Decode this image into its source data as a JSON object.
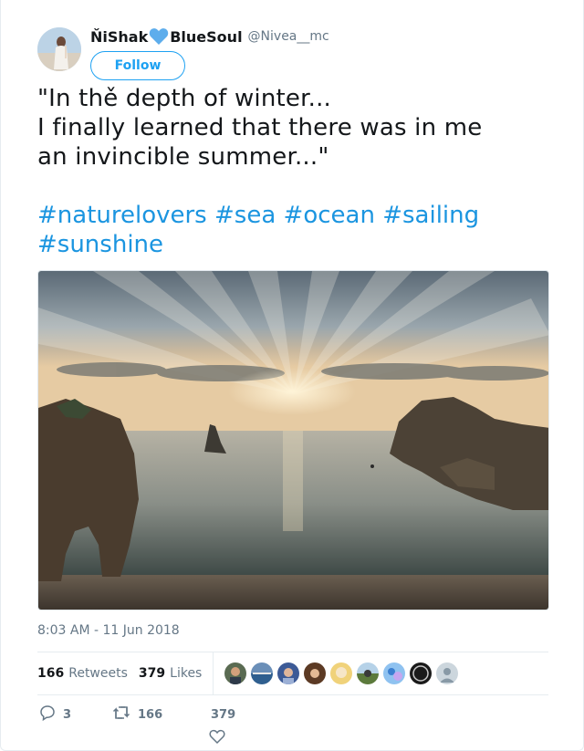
{
  "user": {
    "display_name_part1": "ŇiShak",
    "display_name_part2": "BlueSoul",
    "handle": "@Nivea__mc",
    "heart_emoji": "blue-heart-icon"
  },
  "follow_label": "Follow",
  "tweet": {
    "text": "\"In thě depth of winter...\n I finally learned that there was in me\nan invincible summer...\"",
    "hashtags": [
      "#naturelovers",
      "#sea",
      "#ocean",
      "#sailing",
      "#sunshine"
    ]
  },
  "timestamp": "8:03 AM - 11 Jun 2018",
  "stats": {
    "retweets_count": "166",
    "retweets_label": "Retweets",
    "likes_count": "379",
    "likes_label": "Likes"
  },
  "actions": {
    "reply_count": "3",
    "retweet_count": "166",
    "like_count": "379"
  },
  "colors": {
    "accent": "#1da1f2",
    "hashtag": "#1b95e0",
    "muted": "#657786"
  }
}
